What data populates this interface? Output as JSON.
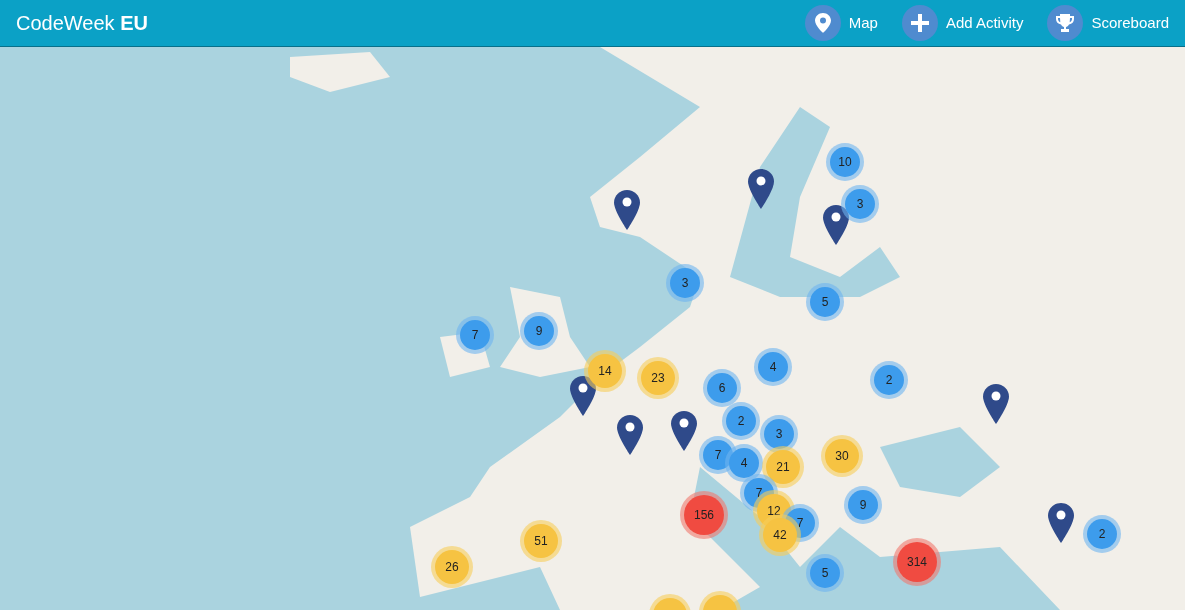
{
  "header": {
    "brand": "CodeWeek **EU**",
    "nav": [
      {
        "label": "Map"
      },
      {
        "label": "Add Activity"
      },
      {
        "label": "Scoreboard"
      }
    ]
  },
  "map": {
    "markers": [
      {
        "kind": "pin"
      },
      {
        "kind": "pin"
      },
      {
        "kind": "pin"
      },
      {
        "kind": "pin"
      },
      {
        "kind": "pin"
      },
      {
        "kind": "pin"
      },
      {
        "kind": "pin"
      },
      {
        "kind": "pin"
      },
      {
        "kind": "small",
        "count": "10"
      },
      {
        "kind": "small",
        "count": "3"
      },
      {
        "kind": "small",
        "count": "3"
      },
      {
        "kind": "small",
        "count": "5"
      },
      {
        "kind": "small",
        "count": "7"
      },
      {
        "kind": "small",
        "count": "9"
      },
      {
        "kind": "medium",
        "count": "14"
      },
      {
        "kind": "medium",
        "count": "23"
      },
      {
        "kind": "small",
        "count": "6"
      },
      {
        "kind": "small",
        "count": "4"
      },
      {
        "kind": "small",
        "count": "2"
      },
      {
        "kind": "small",
        "count": "2"
      },
      {
        "kind": "small",
        "count": "3"
      },
      {
        "kind": "medium",
        "count": "30"
      },
      {
        "kind": "small",
        "count": "7"
      },
      {
        "kind": "small",
        "count": "4"
      },
      {
        "kind": "medium",
        "count": "21"
      },
      {
        "kind": "small",
        "count": "7"
      },
      {
        "kind": "large",
        "count": "156"
      },
      {
        "kind": "medium",
        "count": "12"
      },
      {
        "kind": "small",
        "count": "7"
      },
      {
        "kind": "small",
        "count": "9"
      },
      {
        "kind": "medium",
        "count": "42"
      },
      {
        "kind": "medium",
        "count": "51"
      },
      {
        "kind": "medium",
        "count": "26"
      },
      {
        "kind": "small",
        "count": "5"
      },
      {
        "kind": "large",
        "count": "314"
      },
      {
        "kind": "small",
        "count": "2"
      },
      {
        "kind": "medium"
      },
      {
        "kind": "medium"
      }
    ]
  }
}
